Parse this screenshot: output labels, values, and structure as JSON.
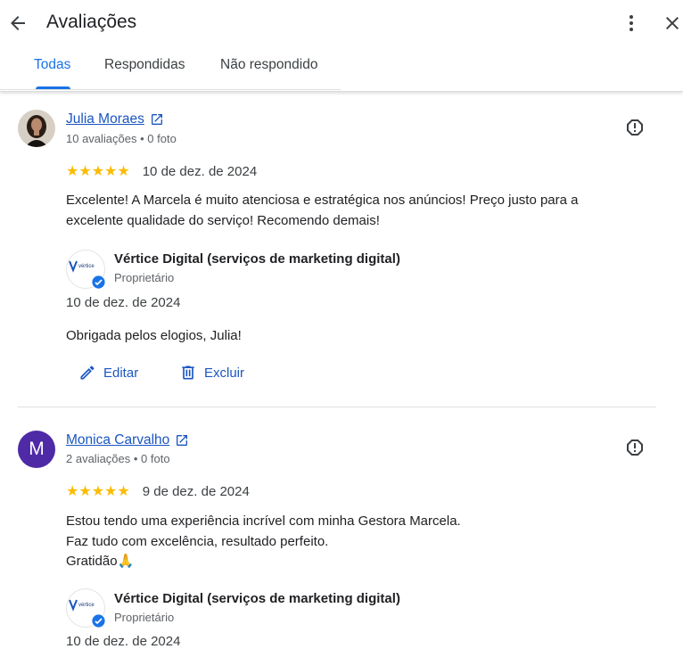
{
  "header": {
    "title": "Avaliações",
    "back_icon": "arrow-back-icon",
    "more_icon": "more-vert-icon",
    "close_icon": "close-icon"
  },
  "tabs": [
    {
      "label": "Todas",
      "active": true
    },
    {
      "label": "Respondidas",
      "active": false
    },
    {
      "label": "Não respondido",
      "active": false
    }
  ],
  "colors": {
    "accent": "#1a73e8",
    "star": "#fbbc04",
    "link": "#1a56c0",
    "avatar_m": "#4e2aa6"
  },
  "reviews": [
    {
      "name": "Julia Moraes",
      "meta": "10 avaliações • 0 foto",
      "stars": 5,
      "date": "10 de dez. de 2024",
      "text_lines": [
        "Excelente! A Marcela é muito atenciosa e estratégica nos anúncios! Preço justo para a",
        "excelente qualidade do serviço! Recomendo demais!"
      ],
      "owner_name": "Vértice Digital (serviços de marketing digital)",
      "owner_role": "Proprietário",
      "reply_date": "10 de dez. de 2024",
      "reply_text": "Obrigada pelos elogios, Julia!",
      "edit_label": "Editar",
      "delete_label": "Excluir"
    },
    {
      "name": "Monica Carvalho",
      "avatar_letter": "M",
      "meta": "2 avaliações • 0 foto",
      "stars": 5,
      "date": "9 de dez. de 2024",
      "text_lines": [
        "Estou tendo uma experiência incrível com minha Gestora Marcela.",
        "Faz tudo com excelência, resultado perfeito.",
        "Gratidão🙏"
      ],
      "owner_name": "Vértice Digital (serviços de marketing digital)",
      "owner_role": "Proprietário",
      "reply_date": "10 de dez. de 2024"
    }
  ],
  "logo_text": "vértice",
  "stars_glyph": "★★★★★"
}
